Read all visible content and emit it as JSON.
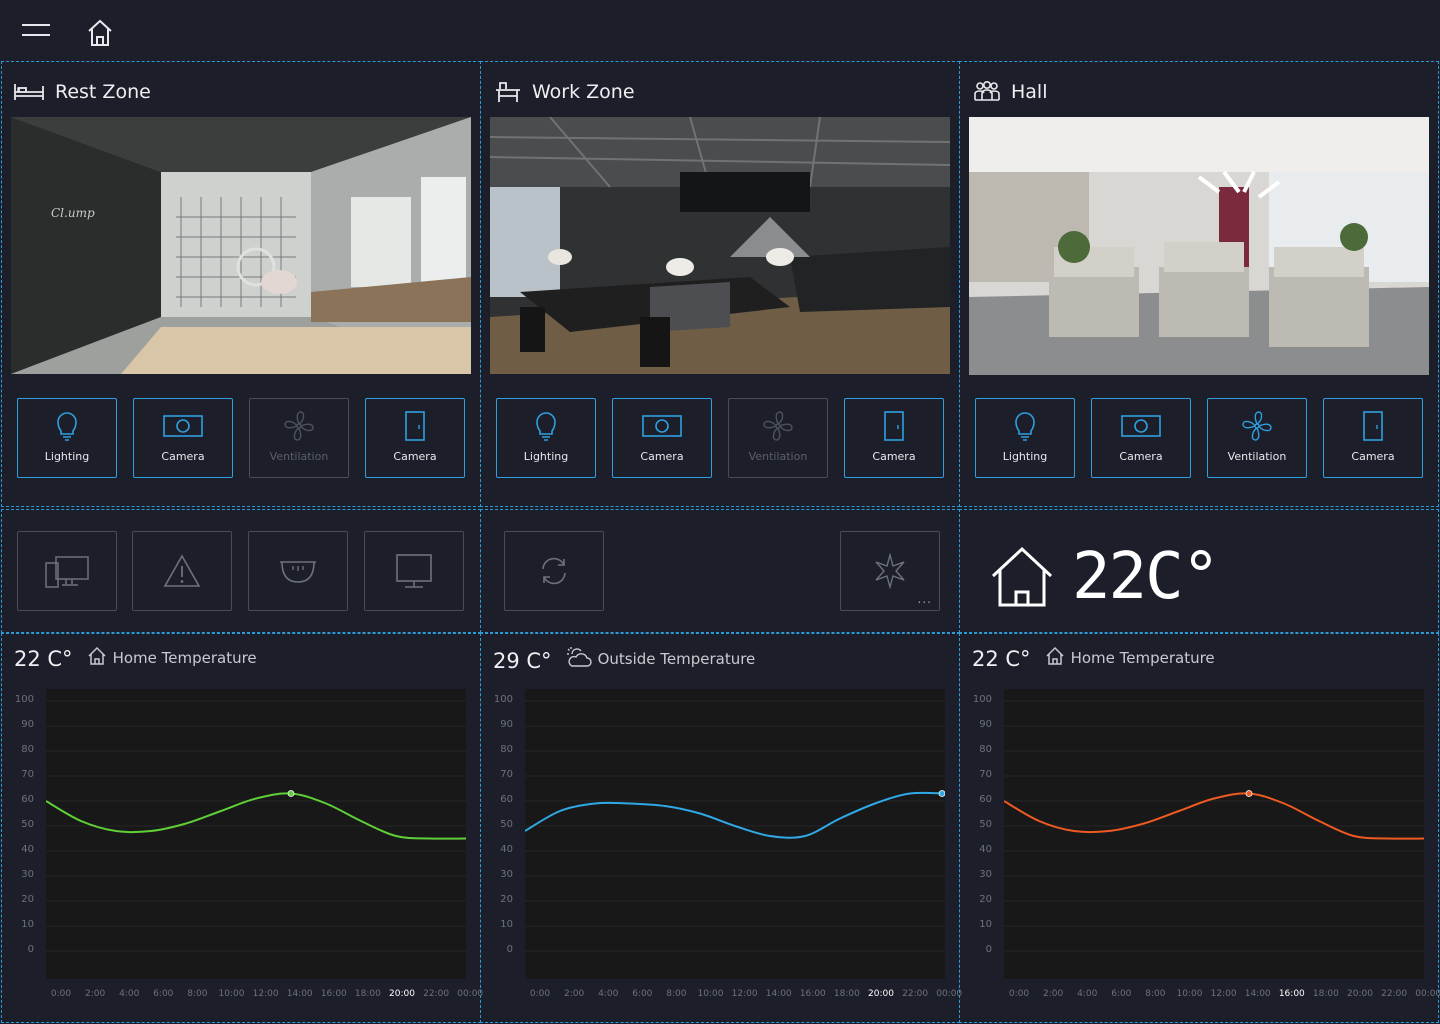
{
  "topbar": {
    "menu_icon": "hamburger-menu-icon",
    "home_icon": "home-icon"
  },
  "zones": [
    {
      "title": "Rest Zone",
      "icon": "bed-icon",
      "devices": [
        {
          "label": "Lighting",
          "icon": "lightbulb-icon",
          "state": "on"
        },
        {
          "label": "Camera",
          "icon": "camera-icon",
          "state": "on"
        },
        {
          "label": "Ventilation",
          "icon": "fan-icon",
          "state": "off"
        },
        {
          "label": "Camera",
          "icon": "door-icon",
          "state": "on"
        }
      ]
    },
    {
      "title": "Work Zone",
      "icon": "desk-icon",
      "devices": [
        {
          "label": "Lighting",
          "icon": "lightbulb-icon",
          "state": "on"
        },
        {
          "label": "Camera",
          "icon": "camera-icon",
          "state": "on"
        },
        {
          "label": "Ventilation",
          "icon": "fan-icon",
          "state": "off"
        },
        {
          "label": "Camera",
          "icon": "door-icon",
          "state": "on"
        }
      ]
    },
    {
      "title": "Hall",
      "icon": "people-icon",
      "devices": [
        {
          "label": "Lighting",
          "icon": "lightbulb-icon",
          "state": "on"
        },
        {
          "label": "Camera",
          "icon": "camera-icon",
          "state": "on"
        },
        {
          "label": "Ventilation",
          "icon": "fan-icon",
          "state": "on"
        },
        {
          "label": "Camera",
          "icon": "door-icon",
          "state": "on"
        }
      ]
    }
  ],
  "quick_actions": {
    "left": [
      "computer-icon",
      "warning-icon",
      "dome-camera-icon",
      "monitor-icon"
    ],
    "middle": [
      "refresh-icon",
      "sparkle-icon"
    ],
    "middle_more": "..."
  },
  "home_status": {
    "icon": "home-icon",
    "temperature": "22C°"
  },
  "charts_header": [
    {
      "value": "22 C°",
      "label": "Home Temperature",
      "icon": "home-icon"
    },
    {
      "value": "29 C°",
      "label": "Outside Temperature",
      "icon": "cloud-sun-icon"
    },
    {
      "value": "22 C°",
      "label": "Home Temperature",
      "icon": "home-icon"
    }
  ],
  "chart_data": [
    {
      "type": "line",
      "color": "#5fcf38",
      "x": [
        "0:00",
        "2:00",
        "4:00",
        "6:00",
        "8:00",
        "10:00",
        "12:00",
        "14:00",
        "16:00",
        "18:00",
        "20:00",
        "22:00",
        "00:00"
      ],
      "highlight_x": "20:00",
      "ylim": [
        0,
        100
      ],
      "yticks": [
        0,
        10,
        20,
        30,
        40,
        50,
        60,
        70,
        80,
        90,
        100
      ],
      "series": [
        {
          "values": [
            60,
            52,
            48,
            48,
            51,
            56,
            61,
            63,
            59,
            52,
            46,
            45,
            45
          ]
        }
      ],
      "marker_index": 7
    },
    {
      "type": "line",
      "color": "#30a8e6",
      "x": [
        "0:00",
        "2:00",
        "4:00",
        "6:00",
        "8:00",
        "10:00",
        "12:00",
        "14:00",
        "16:00",
        "18:00",
        "20:00",
        "22:00",
        "00:00"
      ],
      "highlight_x": "20:00",
      "ylim": [
        0,
        100
      ],
      "yticks": [
        0,
        10,
        20,
        30,
        40,
        50,
        60,
        70,
        80,
        90,
        100
      ],
      "series": [
        {
          "values": [
            48,
            56,
            59,
            59,
            58,
            55,
            50,
            46,
            46,
            53,
            59,
            63,
            63
          ]
        }
      ],
      "marker_index": 12
    },
    {
      "type": "line",
      "color": "#ef5a22",
      "x": [
        "0:00",
        "2:00",
        "4:00",
        "6:00",
        "8:00",
        "10:00",
        "12:00",
        "14:00",
        "16:00",
        "18:00",
        "20:00",
        "22:00",
        "00:00"
      ],
      "highlight_x": "16:00",
      "ylim": [
        0,
        100
      ],
      "yticks": [
        0,
        10,
        20,
        30,
        40,
        50,
        60,
        70,
        80,
        90,
        100
      ],
      "series": [
        {
          "values": [
            60,
            52,
            48,
            48,
            51,
            56,
            61,
            63,
            59,
            52,
            46,
            45,
            45
          ]
        }
      ],
      "marker_index": 7
    }
  ]
}
